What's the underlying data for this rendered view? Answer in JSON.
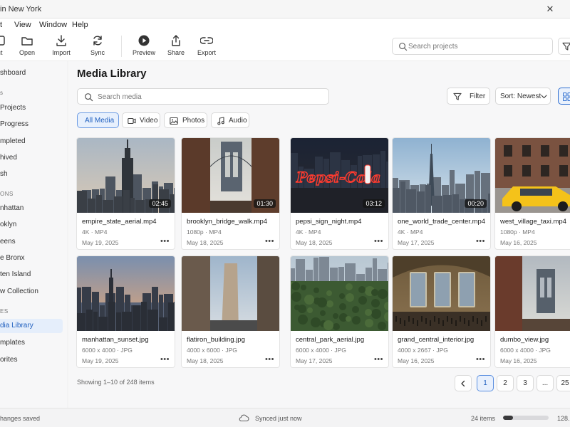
{
  "window": {
    "title": "in New York"
  },
  "menu": [
    "t",
    "View",
    "Window",
    "Help"
  ],
  "toolbar": {
    "buttons": [
      {
        "label": "ct",
        "icon": "new-project-icon"
      },
      {
        "label": "Open",
        "icon": "folder-icon"
      },
      {
        "label": "Import",
        "icon": "import-icon"
      },
      {
        "label": "Sync",
        "icon": "sync-icon"
      },
      {
        "label": "Preview",
        "icon": "play-icon"
      },
      {
        "label": "Share",
        "icon": "share-icon"
      },
      {
        "label": "Export",
        "icon": "export-icon"
      }
    ],
    "search_placeholder": "Search projects"
  },
  "sidebar": {
    "items": [
      {
        "label": "shboard",
        "active": false
      },
      {
        "label": "s",
        "active": false,
        "header": true
      },
      {
        "label": "Projects",
        "active": false
      },
      {
        "label": "Progress",
        "active": false
      },
      {
        "label": "mpleted",
        "active": false
      },
      {
        "label": "hived",
        "active": false
      },
      {
        "label": "sh",
        "active": false
      },
      {
        "label": "ONS",
        "active": false,
        "header": true
      },
      {
        "label": "nhattan",
        "active": false
      },
      {
        "label": "oklyn",
        "active": false
      },
      {
        "label": "eens",
        "active": false
      },
      {
        "label": "e Bronx",
        "active": false
      },
      {
        "label": "ten Island",
        "active": false
      },
      {
        "label": "w Collection",
        "active": false
      },
      {
        "label": "ES",
        "active": false,
        "header": true
      },
      {
        "label": "dia Library",
        "active": true
      },
      {
        "label": "mplates",
        "active": false
      },
      {
        "label": "orites",
        "active": false
      }
    ]
  },
  "main": {
    "title": "Media Library",
    "search_placeholder": "Search media",
    "filter_label": "Filter",
    "sort_label": "Sort: Newest",
    "chips": [
      {
        "label": "All Media",
        "icon": "",
        "active": true
      },
      {
        "label": "Video",
        "icon": "video-icon",
        "active": false
      },
      {
        "label": "Photos",
        "icon": "photo-icon",
        "active": false
      },
      {
        "label": "Audio",
        "icon": "music-icon",
        "active": false
      }
    ],
    "media": [
      {
        "name": "empire_state_aerial.mp4",
        "meta": "4K · MP4",
        "date": "May 19, 2025",
        "duration": "02:45",
        "scene": "empire"
      },
      {
        "name": "brooklyn_bridge_walk.mp4",
        "meta": "1080p · MP4",
        "date": "May 18, 2025",
        "duration": "01:30",
        "scene": "bridge"
      },
      {
        "name": "pepsi_sign_night.mp4",
        "meta": "4K · MP4",
        "date": "May 18, 2025",
        "duration": "03:12",
        "scene": "pepsi"
      },
      {
        "name": "one_world_trade_center.mp4",
        "meta": "4K · MP4",
        "date": "May 17, 2025",
        "duration": "00:20",
        "scene": "owtc"
      },
      {
        "name": "west_village_taxi.mp4",
        "meta": "1080p · MP4",
        "date": "May 16, 2025",
        "duration": "",
        "scene": "taxi"
      },
      {
        "name": "manhattan_sunset.jpg",
        "meta": "6000 x 4000 · JPG",
        "date": "May 19, 2025",
        "duration": "",
        "scene": "sunset"
      },
      {
        "name": "flatiron_building.jpg",
        "meta": "4000 x 6000 · JPG",
        "date": "May 18, 2025",
        "duration": "",
        "scene": "flatiron"
      },
      {
        "name": "central_park_aerial.jpg",
        "meta": "6000 x 4000 · JPG",
        "date": "May 17, 2025",
        "duration": "",
        "scene": "park"
      },
      {
        "name": "grand_central_interior.jpg",
        "meta": "4000 x 2667 · JPG",
        "date": "May 16, 2025",
        "duration": "",
        "scene": "grandcentral"
      },
      {
        "name": "dumbo_view.jpg",
        "meta": "6000 x 4000 · JPG",
        "date": "May 16, 2025",
        "duration": "",
        "scene": "dumbo"
      }
    ],
    "showing_text": "Showing 1–10 of 248 items",
    "pagination": [
      "1",
      "2",
      "3",
      "...",
      "25"
    ],
    "current_page": "1",
    "pepsi_sign_text": "Pepsi-Cola"
  },
  "status": {
    "left": "hanges saved",
    "synced": "Synced just now",
    "count": "24 items",
    "storage": "128.",
    "storage_fraction": 0.22
  },
  "colors": {
    "accent": "#2f6fd1",
    "sidebar_active_bg": "#e5eefb",
    "pepsi_neon": "#ff3b2f"
  }
}
